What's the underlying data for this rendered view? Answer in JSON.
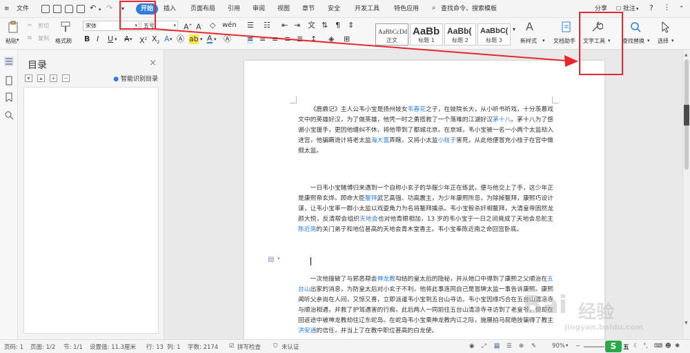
{
  "menubar": {
    "file": "文件",
    "tabs": [
      "开始",
      "插入",
      "页面布局",
      "引用",
      "审阅",
      "视图",
      "章节",
      "安全",
      "开发工具",
      "特色应用"
    ],
    "search": "查找命令、搜索模板",
    "share": "分享",
    "comment": "批注",
    "help": "?"
  },
  "ribbon": {
    "paste": "粘贴",
    "cut": "剪切",
    "copy": "复制",
    "format_painter": "格式刷",
    "font_name": "宋体",
    "font_size": "五号",
    "style_preview": "AaBbCcDd",
    "styles": [
      {
        "preview": "AaBbCcDd",
        "name": "正文"
      },
      {
        "preview": "AaBb",
        "name": "标题 1"
      },
      {
        "preview": "AaBb(",
        "name": "标题 2"
      },
      {
        "preview": "AaBbC(",
        "name": "标题 3"
      }
    ],
    "new_style": "新样式",
    "doc_assistant": "文档助手",
    "text_tools": "文字工具",
    "find_replace": "查找替换",
    "select": "选择",
    "format_chars": "B I U A X² X₂ A ab A A"
  },
  "toc": {
    "title": "目录",
    "close": "×",
    "smart": "智能识别目录"
  },
  "document": {
    "paragraphs": [
      {
        "segments": [
          {
            "t": "《鹿鼎记》主人公韦小宝是扬州妓女"
          },
          {
            "t": "韦春花",
            "h": true
          },
          {
            "t": "之子，在妓院长大，从小听书听戏，十分羡慕戏文中的英雄好汉，为了做英雄，他凭一时之勇搭救了一个落难的江湖好汉"
          },
          {
            "t": "茅十八",
            "h": true
          },
          {
            "t": "。茅十八为了感谢小宝援手，更因他缠纠不休，将他带到了都城北京。在京城，韦小宝被一名一小两个太监劫入进宫，他骗瞒诡计将老太监"
          },
          {
            "t": "海大富",
            "h": true
          },
          {
            "t": "弄瞎，又将小太监"
          },
          {
            "t": "小桂子",
            "h": true
          },
          {
            "t": "害死，从此他便冒充小桂子在宫中做假太监。"
          }
        ]
      },
      {
        "segments": [
          {
            "t": "一日韦小宝赌博归来遇到一个自称小玄子的华服少年正在练武，便与他交上了手，这少年正是康熙帝玄烨。顾命大臣"
          },
          {
            "t": "鳌拜",
            "h": true
          },
          {
            "t": "武艺高强、功高震主，为少年康熙所忌，为除掉鳌拜，康熙巧设计谋，让韦小宝率一群小太监以戏耍角力为名将鳌拜擒杀。韦小宝智杀奸相鳌拜，大清皇帝固然龙颜大悦，反清帮会组织"
          },
          {
            "t": "天地会",
            "h": true
          },
          {
            "t": "也对他青眼相加，13 岁的韦小宝于一日之间竟成了天地会总舵主"
          },
          {
            "t": "陈近南",
            "h": true
          },
          {
            "t": "的关门弟子和地位甚高的天地会青木堂香主。韦小宝奉陈近南之命回宫卧底。"
          }
        ]
      },
      {
        "segments": [
          {
            "t": "一次他撞破了与邪恶帮会"
          },
          {
            "t": "神龙教",
            "h": true
          },
          {
            "t": "勾结的皇太后的隐秘，并从她口中得到了康熙之父顺治在"
          },
          {
            "t": "五台山",
            "h": true
          },
          {
            "t": "出家的消息，为防皇太后对小玄子不利，他将此事连同自己是冒牌太监一事告诉康熙。康熙闻听父亲尚在人间，又惊又喜，立即派遣韦小宝到五台山寻访。韦小宝因缘巧合在五台山清凉寺与顺治相遇，并救了护驾遇害的行痴，此后两人一同前往五台山清凉寺寻访到了老皇爷，但却在回返途中被神龙教劫往辽东蛇岛。在蛇岛韦小宝乘神龙教内讧之际，施展拍马屁绝技骗得了教主"
          },
          {
            "t": "洪安通",
            "h": true
          },
          {
            "t": "的信任，并当上了在教中职位甚高的白龙使。"
          }
        ]
      }
    ]
  },
  "statusbar": {
    "page_num": "页码: 1",
    "pages": "页面: 1/2",
    "section": "节: 1/1",
    "setting": "设置值: 11.3厘米",
    "row": "行: 13",
    "col": "列: 1",
    "words": "字数: 2174",
    "spell": "拼写检查",
    "cert": "未认证",
    "zoom": "90%",
    "badge": "五"
  },
  "watermark": {
    "brand": "Bai",
    "brand2": "经验",
    "url": "jingyan.baidu.com"
  },
  "colors": {
    "accent": "#2e7de0",
    "annotation": "#e8262d"
  }
}
